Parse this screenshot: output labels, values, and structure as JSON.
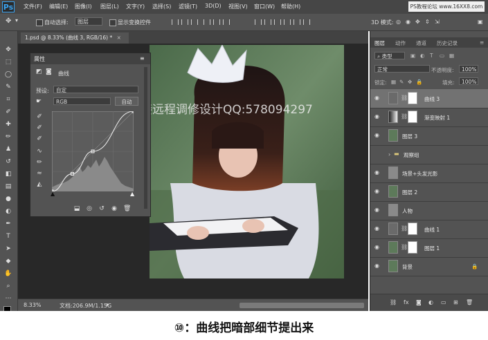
{
  "app": {
    "logo": "Ps"
  },
  "menu": [
    "文件(F)",
    "编辑(E)",
    "图像(I)",
    "图层(L)",
    "文字(Y)",
    "选择(S)",
    "滤镜(T)",
    "3D(D)",
    "视图(V)",
    "窗口(W)",
    "帮助(H)"
  ],
  "site_mark": "PS教程论坛 www.16XX8.com",
  "options": {
    "auto_select": "自动选择:",
    "target": "图层",
    "show_transform": "显示变换控件",
    "mode_3d": "3D 模式:"
  },
  "document": {
    "tab": "1.psd @ 8.33% (曲线 3, RGB/16) *",
    "zoom": "8.33%",
    "doc_size": "文档:206.9M/1.15G"
  },
  "watermark": "接远程调修设计QQ:578094297",
  "properties": {
    "panel_title": "属性",
    "adjustment": "曲线",
    "preset_label": "预设:",
    "preset_value": "自定",
    "channel": "RGB",
    "auto_button": "自动"
  },
  "curve_points": [
    [
      0.0,
      0.0
    ],
    [
      0.25,
      0.22
    ],
    [
      0.5,
      0.5
    ],
    [
      1.0,
      1.0
    ]
  ],
  "layers_panel": {
    "tabs": [
      "图层",
      "动作",
      "通道",
      "历史记录"
    ],
    "filter": "类型",
    "blend_mode": "正常",
    "opacity_label": "不透明度:",
    "opacity": "100%",
    "lock_label": "锁定:",
    "fill_label": "填充:",
    "fill": "100%",
    "layers": [
      {
        "name": "曲线 3",
        "type": "adjust",
        "mask": true,
        "selected": true
      },
      {
        "name": "渐变映射 1",
        "type": "gradient",
        "mask": true,
        "selected": false
      },
      {
        "name": "图层 3",
        "type": "photo",
        "mask": false,
        "selected": false
      },
      {
        "name": "观察组",
        "type": "group",
        "mask": false,
        "selected": false
      },
      {
        "name": "场景+头发光影",
        "type": "gray",
        "mask": false,
        "selected": false
      },
      {
        "name": "图层 2",
        "type": "photo",
        "mask": false,
        "selected": false
      },
      {
        "name": "人物",
        "type": "gray",
        "mask": false,
        "selected": false
      },
      {
        "name": "曲线 1",
        "type": "adjust",
        "mask": true,
        "selected": false
      },
      {
        "name": "图层 1",
        "type": "photo",
        "mask": true,
        "selected": false
      },
      {
        "name": "背景",
        "type": "photo",
        "mask": false,
        "selected": false
      }
    ]
  },
  "caption": "⑩：曲线把暗部细节提出来"
}
